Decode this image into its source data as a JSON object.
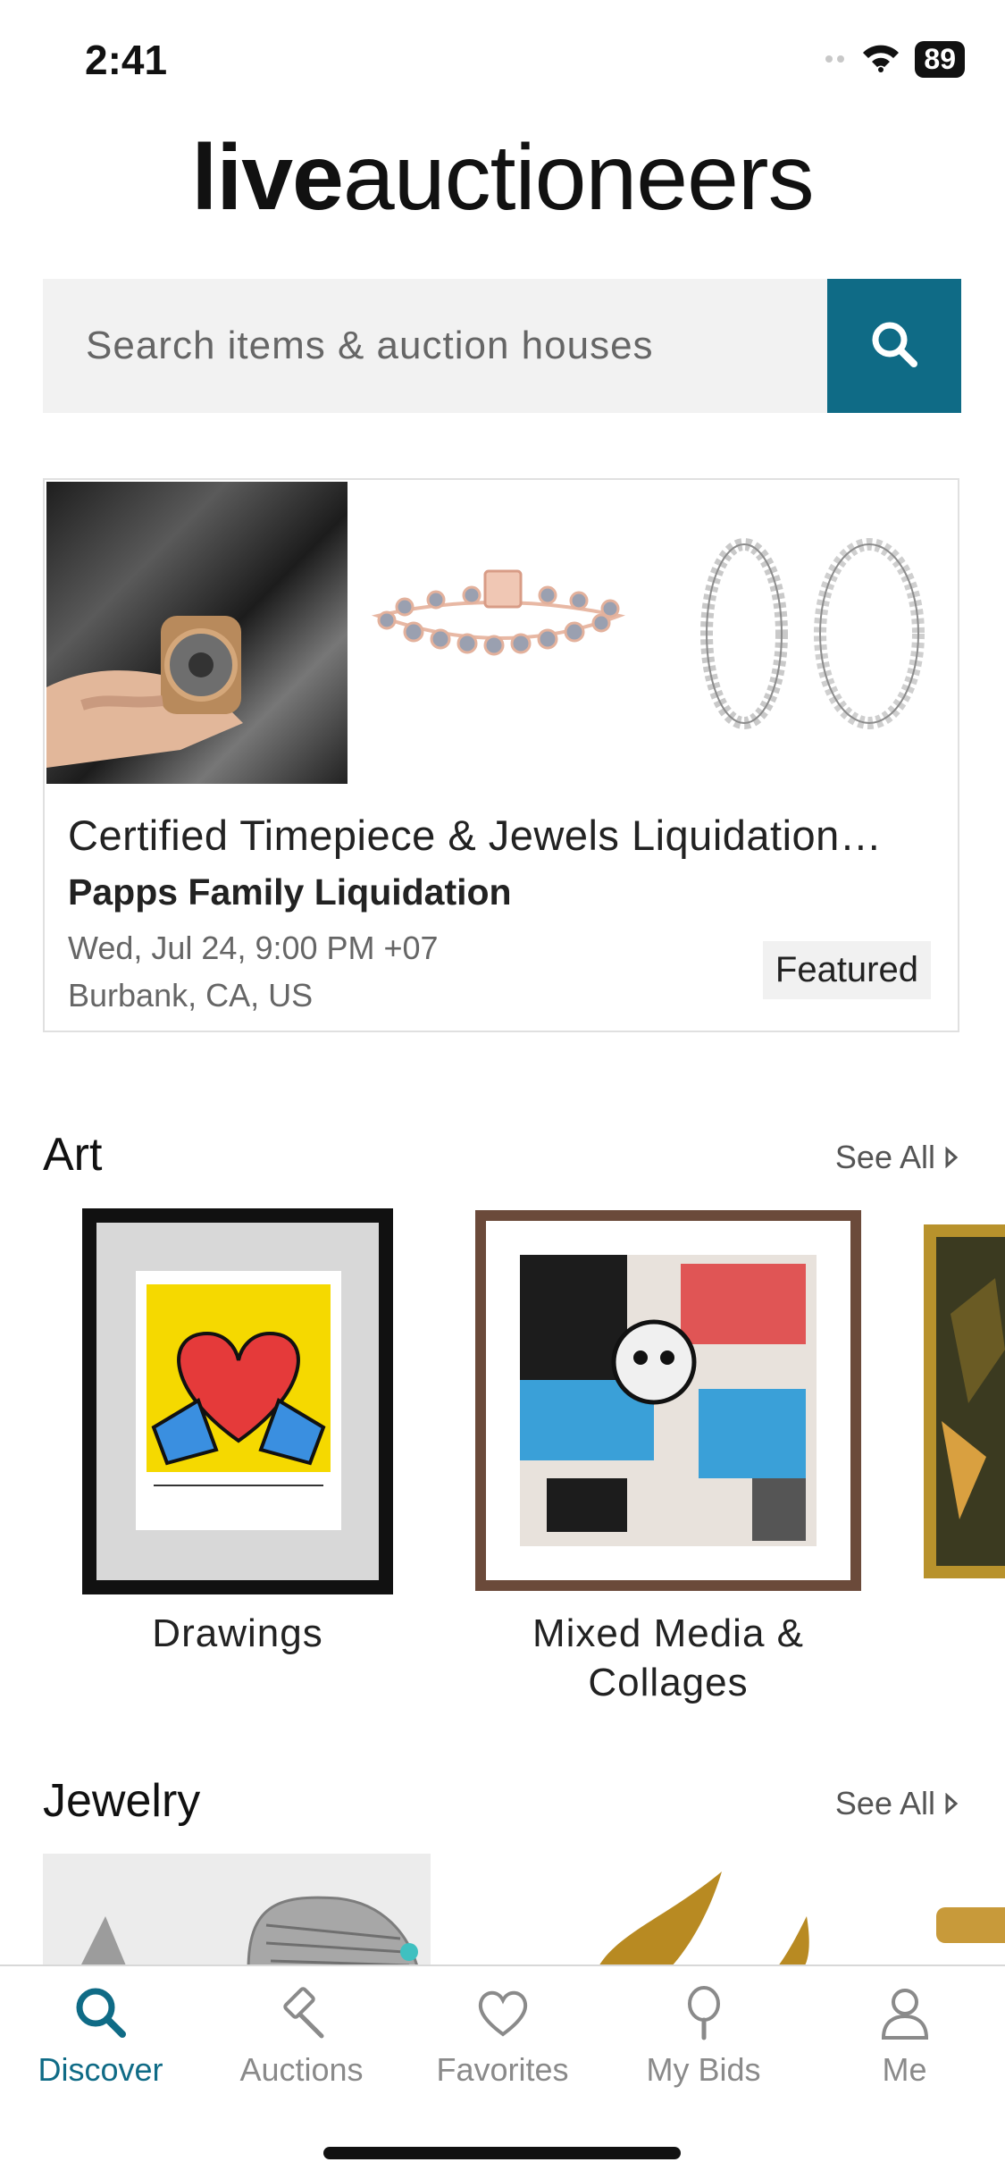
{
  "status": {
    "time": "2:41",
    "battery": "89"
  },
  "logo": {
    "bold": "live",
    "regular": "auctioneers"
  },
  "search": {
    "placeholder": "Search items & auction houses"
  },
  "featured": {
    "title": "Certified Timepiece & Jewels Liquidation…",
    "house": "Papps Family Liquidation",
    "date": "Wed, Jul 24, 9:00 PM +07",
    "location": "Burbank, CA, US",
    "badge": "Featured"
  },
  "sections": {
    "art": {
      "title": "Art",
      "see_all": "See All",
      "categories": [
        "Drawings",
        "Mixed Media & Collages"
      ]
    },
    "jewelry": {
      "title": "Jewelry",
      "see_all": "See All"
    }
  },
  "tabs": [
    {
      "label": "Discover",
      "icon": "search-icon",
      "active": true
    },
    {
      "label": "Auctions",
      "icon": "gavel-icon",
      "active": false
    },
    {
      "label": "Favorites",
      "icon": "heart-icon",
      "active": false
    },
    {
      "label": "My Bids",
      "icon": "paddle-icon",
      "active": false
    },
    {
      "label": "Me",
      "icon": "user-icon",
      "active": false
    }
  ],
  "colors": {
    "accent": "#0f6b86",
    "inactive": "#8a8a8a"
  }
}
